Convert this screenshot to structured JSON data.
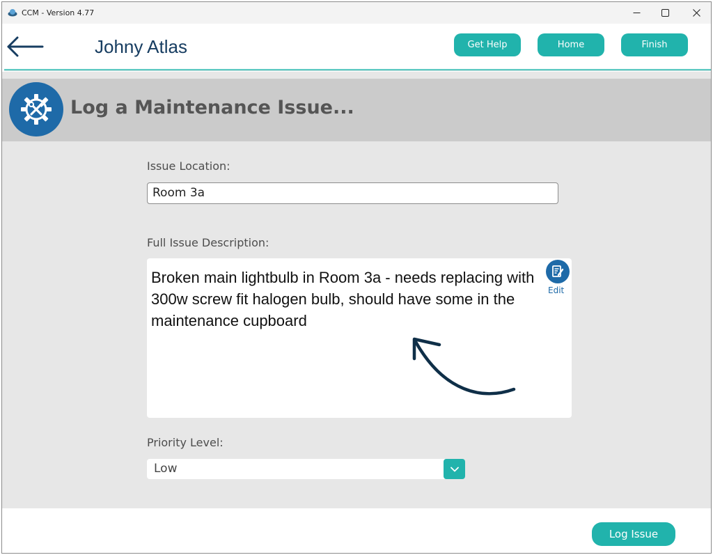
{
  "window": {
    "title": "CCM - Version 4.77"
  },
  "header": {
    "user_name": "Johny Atlas",
    "buttons": {
      "get_help": "Get Help",
      "home": "Home",
      "finish": "Finish"
    }
  },
  "banner": {
    "title": "Log a Maintenance Issue...",
    "icon": "gear-wrench-icon"
  },
  "form": {
    "location_label": "Issue Location:",
    "location_value": "Room 3a",
    "description_label": "Full Issue Description:",
    "description_value": "Broken main lightbulb in Room 3a - needs replacing with 300w screw fit halogen bulb, should have some in the maintenance cupboard",
    "edit_label": "Edit",
    "priority_label": "Priority Level:",
    "priority_value": "Low"
  },
  "footer": {
    "log_button": "Log Issue"
  },
  "colors": {
    "accent": "#21b3ac",
    "brand_blue": "#1e6aa8",
    "title_navy": "#173d61",
    "banner_gray": "#cbcbcb",
    "panel_gray": "#e7e7e7"
  }
}
